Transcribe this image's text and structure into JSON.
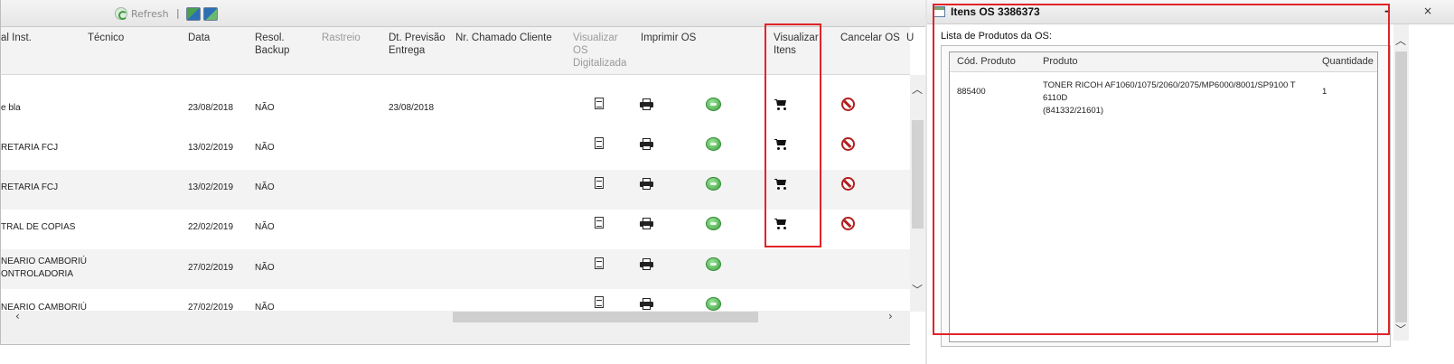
{
  "toolbar": {
    "refresh_label": "Refresh",
    "separator": "|",
    "excel_icon": "excel-export-icon",
    "word_icon": "word-export-icon"
  },
  "grid": {
    "headers": {
      "inst": "al Inst.",
      "tecnico": "Técnico",
      "data": "Data",
      "resol_backup": "Resol.\nBackup",
      "rastreio": "Rastreio",
      "dt_previsao": "Dt. Previsão\nEntrega",
      "nr_chamado": "Nr. Chamado Cliente",
      "visualizar_os": "Visualizar\nOS\nDigitalizada",
      "imprimir_os": "Imprimir OS",
      "visualizar_itens": "Visualizar\nItens",
      "cancelar_os": "Cancelar OS",
      "next_col": "U"
    },
    "rows": [
      {
        "inst": "e bla",
        "data": "23/08/2018",
        "resol": "NÃO",
        "previsao": "23/08/2018",
        "has_cart": true,
        "has_cancel": true
      },
      {
        "inst": "RETARIA FCJ",
        "data": "13/02/2019",
        "resol": "NÃO",
        "previsao": "",
        "has_cart": true,
        "has_cancel": true
      },
      {
        "inst": "RETARIA FCJ",
        "data": "13/02/2019",
        "resol": "NÃO",
        "previsao": "",
        "has_cart": true,
        "has_cancel": true
      },
      {
        "inst": "TRAL DE COPIAS",
        "data": "22/02/2019",
        "resol": "NÃO",
        "previsao": "",
        "has_cart": true,
        "has_cancel": true
      },
      {
        "inst": "NEARIO CAMBORIÚ\nONTROLADORIA",
        "data": "27/02/2019",
        "resol": "NÃO",
        "previsao": "",
        "has_cart": false,
        "has_cancel": false
      },
      {
        "inst": "NEARIO CAMBORIÚ",
        "data": "27/02/2019",
        "resol": "NÃO",
        "previsao": "",
        "has_cart": false,
        "has_cancel": false
      }
    ]
  },
  "dialog": {
    "title": "Itens OS 3386373",
    "minimize": "-",
    "close": "×",
    "subtitle": "Lista de Produtos da OS:",
    "columns": {
      "cod": "Cód. Produto",
      "produto": "Produto",
      "quantidade": "Quantidade"
    },
    "items": [
      {
        "cod": "885400",
        "produto": "TONER RICOH AF1060/1075/2060/2075/MP6000/8001/SP9100 T 6110D\n(841332/21601)",
        "quantidade": "1"
      }
    ]
  },
  "colors": {
    "highlight": "#e1232a",
    "alt_row": "#f3f3f3",
    "cancel": "#b21f1f",
    "chat": "#3ca33c"
  }
}
